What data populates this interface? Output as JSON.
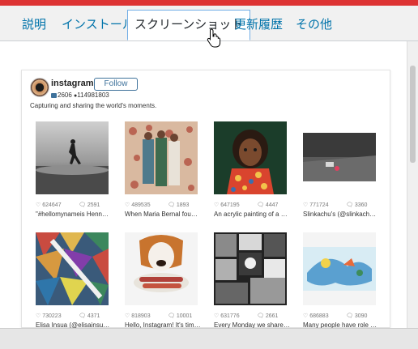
{
  "tabs": [
    {
      "label": "説明"
    },
    {
      "label": "インストール"
    },
    {
      "label": "スクリーンショット",
      "active": true
    },
    {
      "label": "更新履歴"
    },
    {
      "label": "その他"
    }
  ],
  "profile": {
    "username": "instagram",
    "follow_label": "Follow",
    "posts": "2606",
    "followers": "114981803",
    "bio": "Capturing and sharing the world's moments."
  },
  "posts": [
    {
      "likes": "624647",
      "comments": "2591",
      "caption": "\"#hellomynameis Hennessy..."
    },
    {
      "likes": "489535",
      "comments": "1893",
      "caption": "When Maria Bernal found o..."
    },
    {
      "likes": "647195",
      "comments": "4447",
      "caption": "An acrylic painting of a you..."
    },
    {
      "likes": "771724",
      "comments": "3360",
      "caption": "Slinkachu's (@slinkachu_offi..."
    },
    {
      "likes": "730223",
      "comments": "4371",
      "caption": "Elisa Insua (@elisainsua) be..."
    },
    {
      "likes": "818903",
      "comments": "10001",
      "caption": "Hello, Instagram! It's time to..."
    },
    {
      "likes": "631776",
      "comments": "2661",
      "caption": "Every Monday we share so..."
    },
    {
      "likes": "686883",
      "comments": "3090",
      "caption": "Many people have role mod..."
    }
  ],
  "colors": {
    "accent": "#dd3333",
    "link": "#0073aa",
    "follow": "#3f729b"
  }
}
